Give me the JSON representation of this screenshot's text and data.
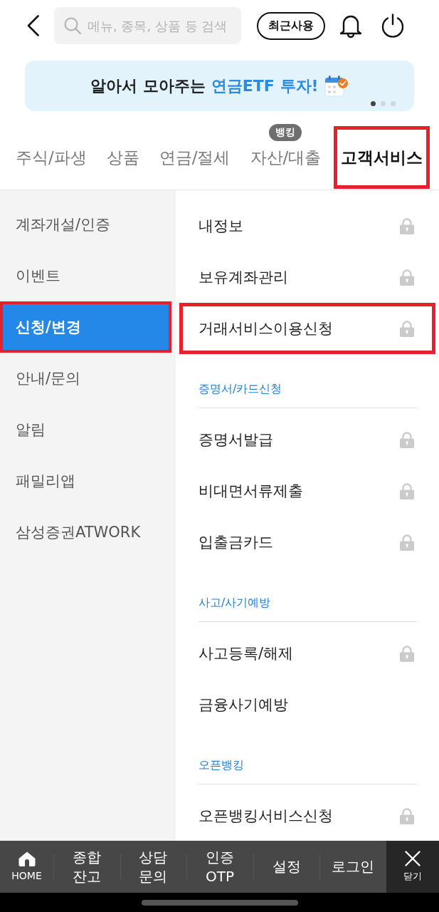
{
  "top_bar": {
    "search": {
      "placeholder": "메뉴, 종목, 상품 등 검색"
    },
    "recent_button": "최근사용"
  },
  "banner": {
    "text_parts": [
      {
        "text": "알아서 모아주는",
        "accent": false
      },
      {
        "text": "연금ETF 투자!",
        "accent": true
      }
    ],
    "page_dots": [
      {
        "selected": true
      },
      {
        "selected": false
      },
      {
        "selected": false
      }
    ]
  },
  "tabs": [
    {
      "label": "주식/파생",
      "selected": false,
      "highlighted": false
    },
    {
      "label": "상품",
      "selected": false,
      "highlighted": false
    },
    {
      "label": "연금/절세",
      "selected": false,
      "highlighted": false
    },
    {
      "label": "자산/대출",
      "badge": "뱅킹",
      "selected": false,
      "highlighted": false
    },
    {
      "label": "고객서비스",
      "selected": true,
      "highlighted": true
    }
  ],
  "sidebar": {
    "items": [
      {
        "label": "계좌개설/인증",
        "selected": false,
        "highlighted": false
      },
      {
        "label": "이벤트",
        "selected": false,
        "highlighted": false
      },
      {
        "label": "신청/변경",
        "selected": true,
        "highlighted": true
      },
      {
        "label": "안내/문의",
        "selected": false,
        "highlighted": false
      },
      {
        "label": "알림",
        "selected": false,
        "highlighted": false
      },
      {
        "label": "패밀리앱",
        "selected": false,
        "highlighted": false
      },
      {
        "label": "삼성증권ATWORK",
        "selected": false,
        "highlighted": false
      }
    ]
  },
  "menu": {
    "sections": [
      {
        "items": [
          {
            "label": "내정보",
            "locked": true,
            "highlighted": false
          },
          {
            "label": "보유계좌관리",
            "locked": true,
            "highlighted": false
          },
          {
            "label": "거래서비스이용신청",
            "locked": true,
            "highlighted": true
          }
        ]
      },
      {
        "heading": "증명서/카드신청",
        "items": [
          {
            "label": "증명서발급",
            "locked": true,
            "highlighted": false
          },
          {
            "label": "비대면서류제출",
            "locked": true,
            "highlighted": false
          },
          {
            "label": "입출금카드",
            "locked": true,
            "highlighted": false
          }
        ]
      },
      {
        "heading": "사고/사기예방",
        "items": [
          {
            "label": "사고등록/해제",
            "locked": true,
            "highlighted": false
          },
          {
            "label": "금융사기예방",
            "locked": false,
            "highlighted": false
          }
        ]
      },
      {
        "heading": "오픈뱅킹",
        "items": [
          {
            "label": "오픈뱅킹서비스신청",
            "locked": true,
            "highlighted": false
          }
        ]
      }
    ]
  },
  "bottom_nav": {
    "items": [
      {
        "kind": "icon",
        "label": "HOME"
      },
      {
        "kind": "text",
        "label": "종합\n잔고"
      },
      {
        "kind": "text",
        "label": "상담\n문의"
      },
      {
        "kind": "text",
        "label": "인증\nOTP"
      },
      {
        "kind": "text",
        "label": "설정"
      },
      {
        "kind": "text",
        "label": "로그인"
      }
    ],
    "close_button": {
      "label": "닫기"
    }
  }
}
